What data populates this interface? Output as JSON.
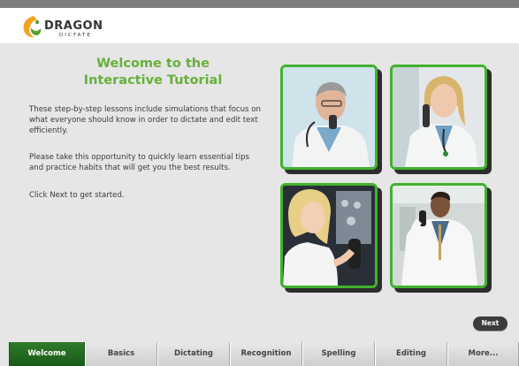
{
  "app": {
    "brand_name": "DRAGON",
    "brand_sub": "DICTATE",
    "brand_color": "#f2a11d",
    "accent_green": "#66b03a"
  },
  "tutorial": {
    "title_line1": "Welcome to the",
    "title_line2": "Interactive Tutorial",
    "paragraph1": "These step-by-step lessons include simulations that focus on what everyone should know in order to dictate and edit text efficiently.",
    "paragraph2": "Please take this opportunity to quickly learn essential tips and practice habits that will get you the best results.",
    "paragraph3": "Click Next to get started."
  },
  "photos": [
    {
      "name": "doctor-dictating-photo"
    },
    {
      "name": "female-doctor-recorder-photo"
    },
    {
      "name": "woman-xray-recorder-photo"
    },
    {
      "name": "doctor-hallway-recorder-photo"
    }
  ],
  "buttons": {
    "next": "Next"
  },
  "tabs": [
    {
      "label": "Welcome",
      "active": true
    },
    {
      "label": "Basics",
      "active": false
    },
    {
      "label": "Dictating",
      "active": false
    },
    {
      "label": "Recognition",
      "active": false
    },
    {
      "label": "Spelling",
      "active": false
    },
    {
      "label": "Editing",
      "active": false
    },
    {
      "label": "More...",
      "active": false
    }
  ]
}
